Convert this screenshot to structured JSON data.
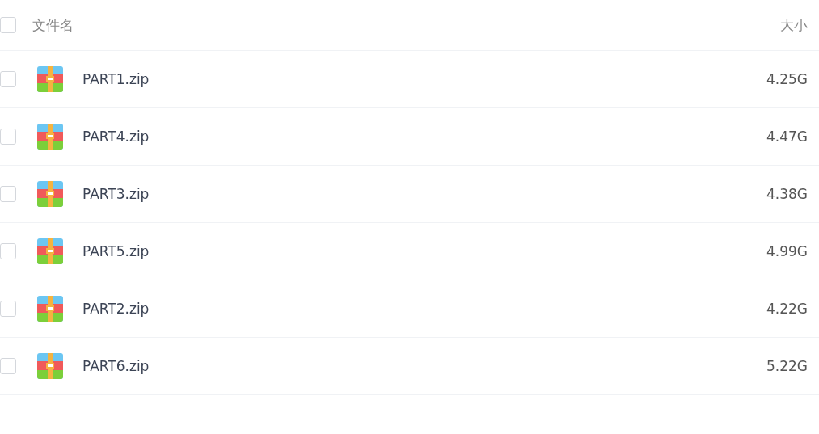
{
  "header": {
    "checked": false,
    "name_column": "文件名",
    "size_column": "大小"
  },
  "rows": [
    {
      "name": "PART1.zip",
      "size": "4.25G",
      "checked": false
    },
    {
      "name": "PART4.zip",
      "size": "4.47G",
      "checked": false
    },
    {
      "name": "PART3.zip",
      "size": "4.38G",
      "checked": false
    },
    {
      "name": "PART5.zip",
      "size": "4.99G",
      "checked": false
    },
    {
      "name": "PART2.zip",
      "size": "4.22G",
      "checked": false
    },
    {
      "name": "PART6.zip",
      "size": "5.22G",
      "checked": false
    }
  ]
}
